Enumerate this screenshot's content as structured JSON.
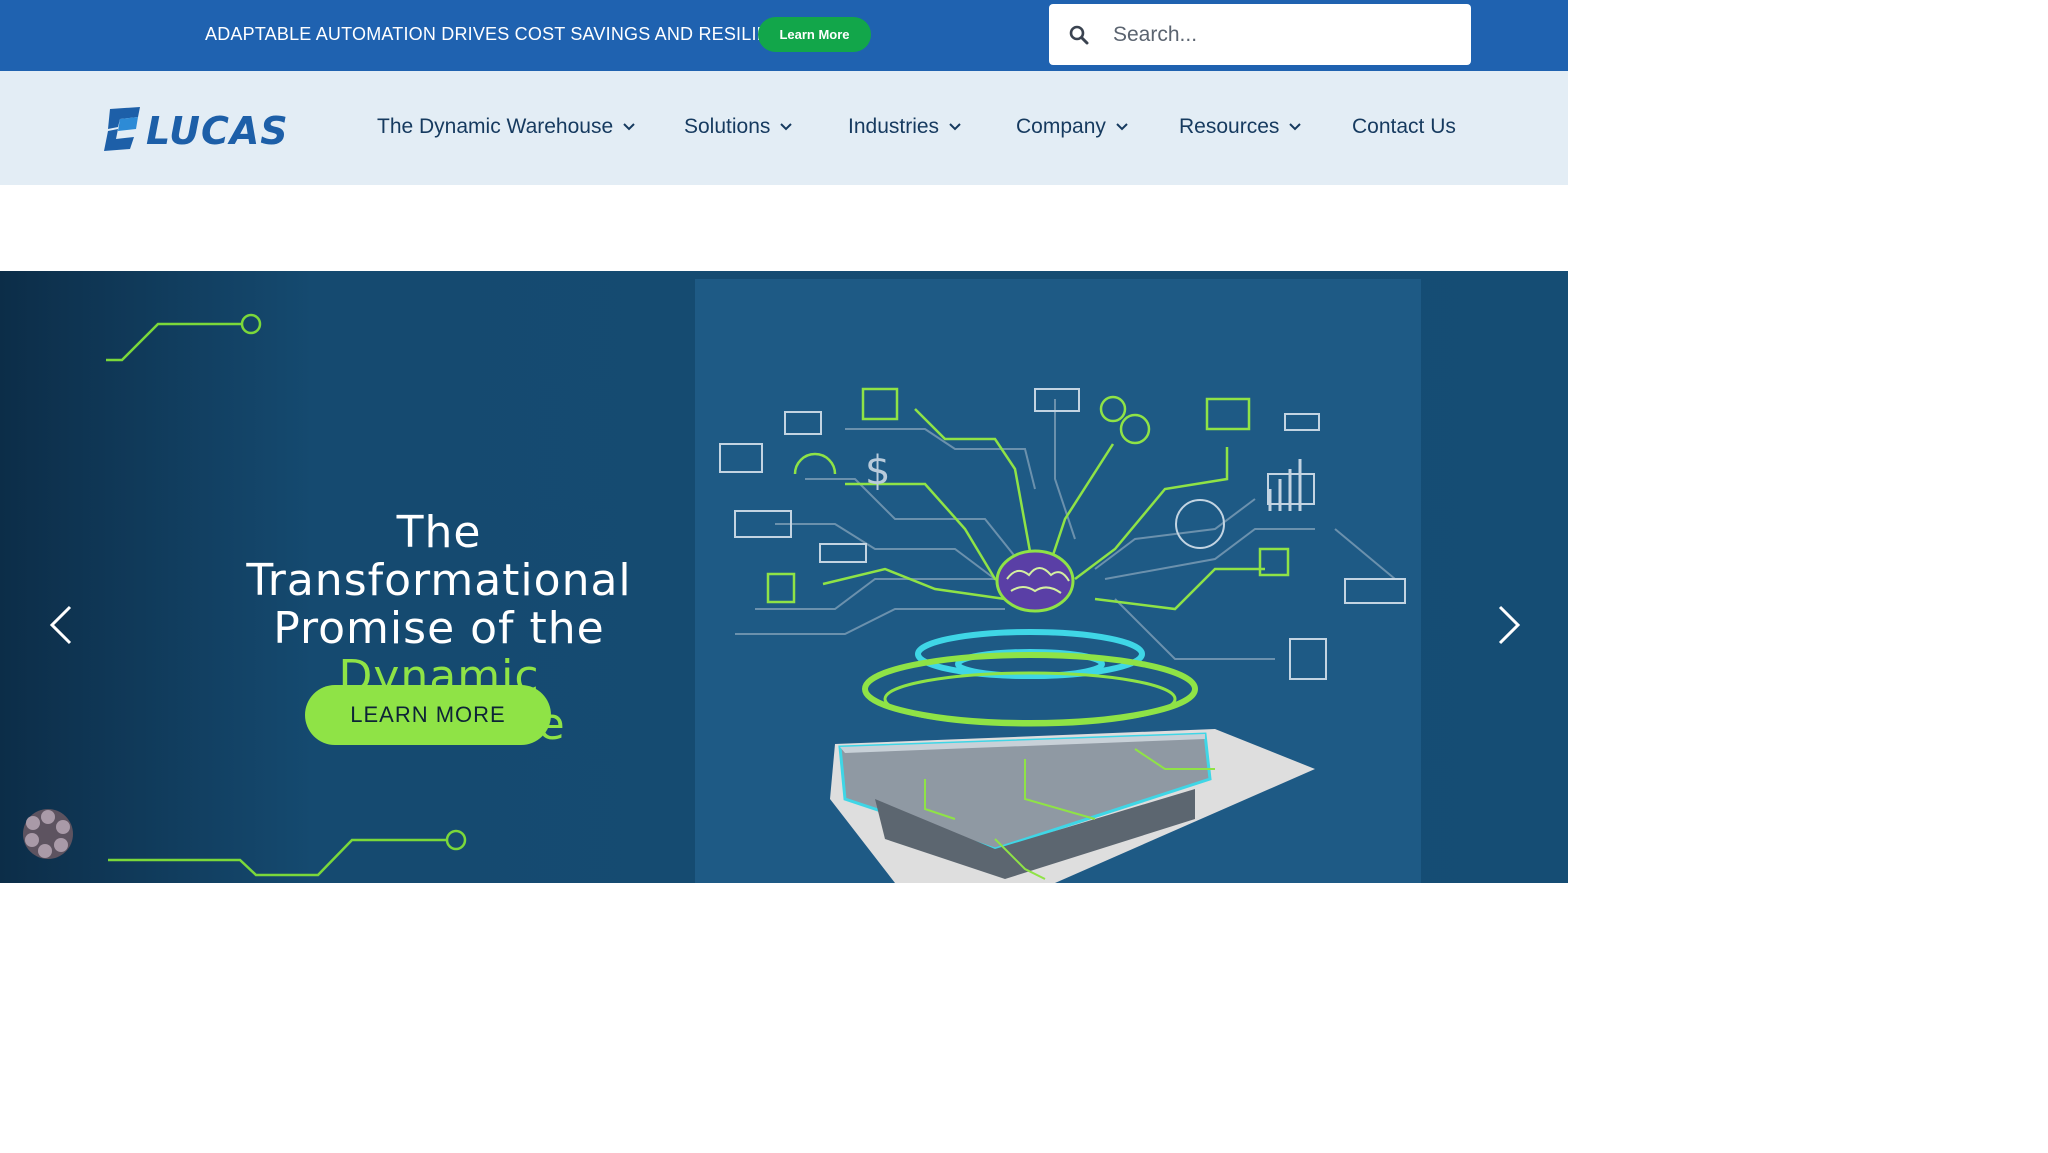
{
  "promo": {
    "text": "ADAPTABLE AUTOMATION DRIVES COST SAVINGS AND RESILIENCE",
    "button_label": "Learn More"
  },
  "search": {
    "placeholder": "Search...",
    "icon": "search-icon"
  },
  "brand": {
    "logo_text": "LUCAS",
    "logo_color": "#1d5fa8"
  },
  "nav": {
    "items": [
      {
        "label": "The Dynamic Warehouse",
        "has_dropdown": true
      },
      {
        "label": "Solutions",
        "has_dropdown": true
      },
      {
        "label": "Industries",
        "has_dropdown": true
      },
      {
        "label": "Company",
        "has_dropdown": true
      },
      {
        "label": "Resources",
        "has_dropdown": true
      },
      {
        "label": "Contact Us",
        "has_dropdown": false
      }
    ]
  },
  "hero": {
    "title_line1": "The Transformational",
    "title_line2": "Promise of the",
    "title_accent": "Dynamic Warehouse",
    "button_label": "LEARN MORE",
    "prev_icon": "chevron-left-icon",
    "next_icon": "chevron-right-icon"
  },
  "colors": {
    "topbar": "#1f62b0",
    "promo_button": "#12a64a",
    "nav_bg": "#e3edf5",
    "hero_bg": "#154d74",
    "accent_green": "#8fe346"
  }
}
